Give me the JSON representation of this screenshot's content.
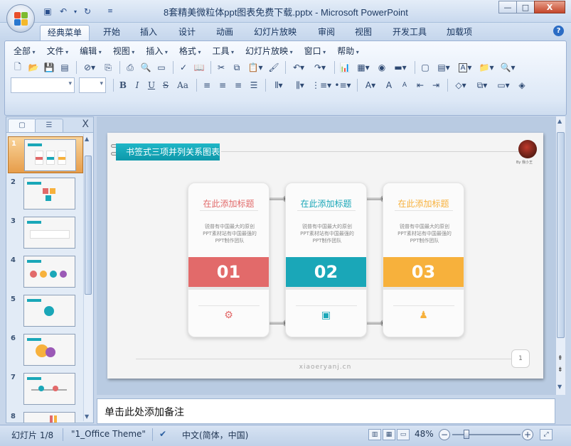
{
  "titlebar": {
    "title": "8套精美微粒体ppt图表免费下载.pptx - Microsoft PowerPoint",
    "qat_icons": [
      "save-icon",
      "undo-icon",
      "redo-icon",
      "customize-icon"
    ],
    "minimize": "—",
    "maximize": "□",
    "close": "X"
  },
  "tabs": [
    {
      "label": "经典菜单",
      "active": true
    },
    {
      "label": "开始"
    },
    {
      "label": "插入"
    },
    {
      "label": "设计"
    },
    {
      "label": "动画"
    },
    {
      "label": "幻灯片放映"
    },
    {
      "label": "审阅"
    },
    {
      "label": "视图"
    },
    {
      "label": "开发工具"
    },
    {
      "label": "加载项"
    }
  ],
  "help": "?",
  "menu": [
    "全部",
    "文件",
    "编辑",
    "视图",
    "插入",
    "格式",
    "工具",
    "幻灯片放映",
    "窗口",
    "帮助"
  ],
  "format": {
    "bold": "B",
    "italic": "I",
    "underline": "U",
    "strike": "S",
    "case": "Aa",
    "font_size_up": "A",
    "font_size_down": "A",
    "text_box": "A"
  },
  "left_panel": {
    "tab_close": "X",
    "slide_numbers": [
      "1",
      "2",
      "3",
      "4",
      "5",
      "6",
      "7",
      "8"
    ]
  },
  "slide": {
    "banner": "书签式三项并列关系图表",
    "logo_caption": "By 我小王",
    "cards": [
      {
        "title": "在此添加标题",
        "desc": "锐普有中国最大的原创PPT素材站有中国最强的PPT制作团队",
        "num": "01",
        "color": "#e26a6a",
        "title_color": "#e26a6a",
        "icon": "gear-people-icon"
      },
      {
        "title": "在此添加标题",
        "desc": "锐普有中国最大的原创PPT素材站有中国最强的PPT制作团队",
        "num": "02",
        "color": "#1aa7b8",
        "title_color": "#1aa7b8",
        "icon": "document-icon"
      },
      {
        "title": "在此添加标题",
        "desc": "锐普有中国最大的原创PPT素材站有中国最强的PPT制作团队",
        "num": "03",
        "color": "#f7b13c",
        "title_color": "#f7b13c",
        "icon": "presenter-icon"
      }
    ],
    "footer": "xiaoeryanj.cn",
    "page": "1"
  },
  "notes": {
    "placeholder": "单击此处添加备注"
  },
  "status": {
    "slide": "幻灯片 1/8",
    "theme": "\"1_Office Theme\"",
    "language": "中文(简体，中国)",
    "zoom": "48%",
    "zoom_minus": "−",
    "zoom_plus": "+"
  }
}
